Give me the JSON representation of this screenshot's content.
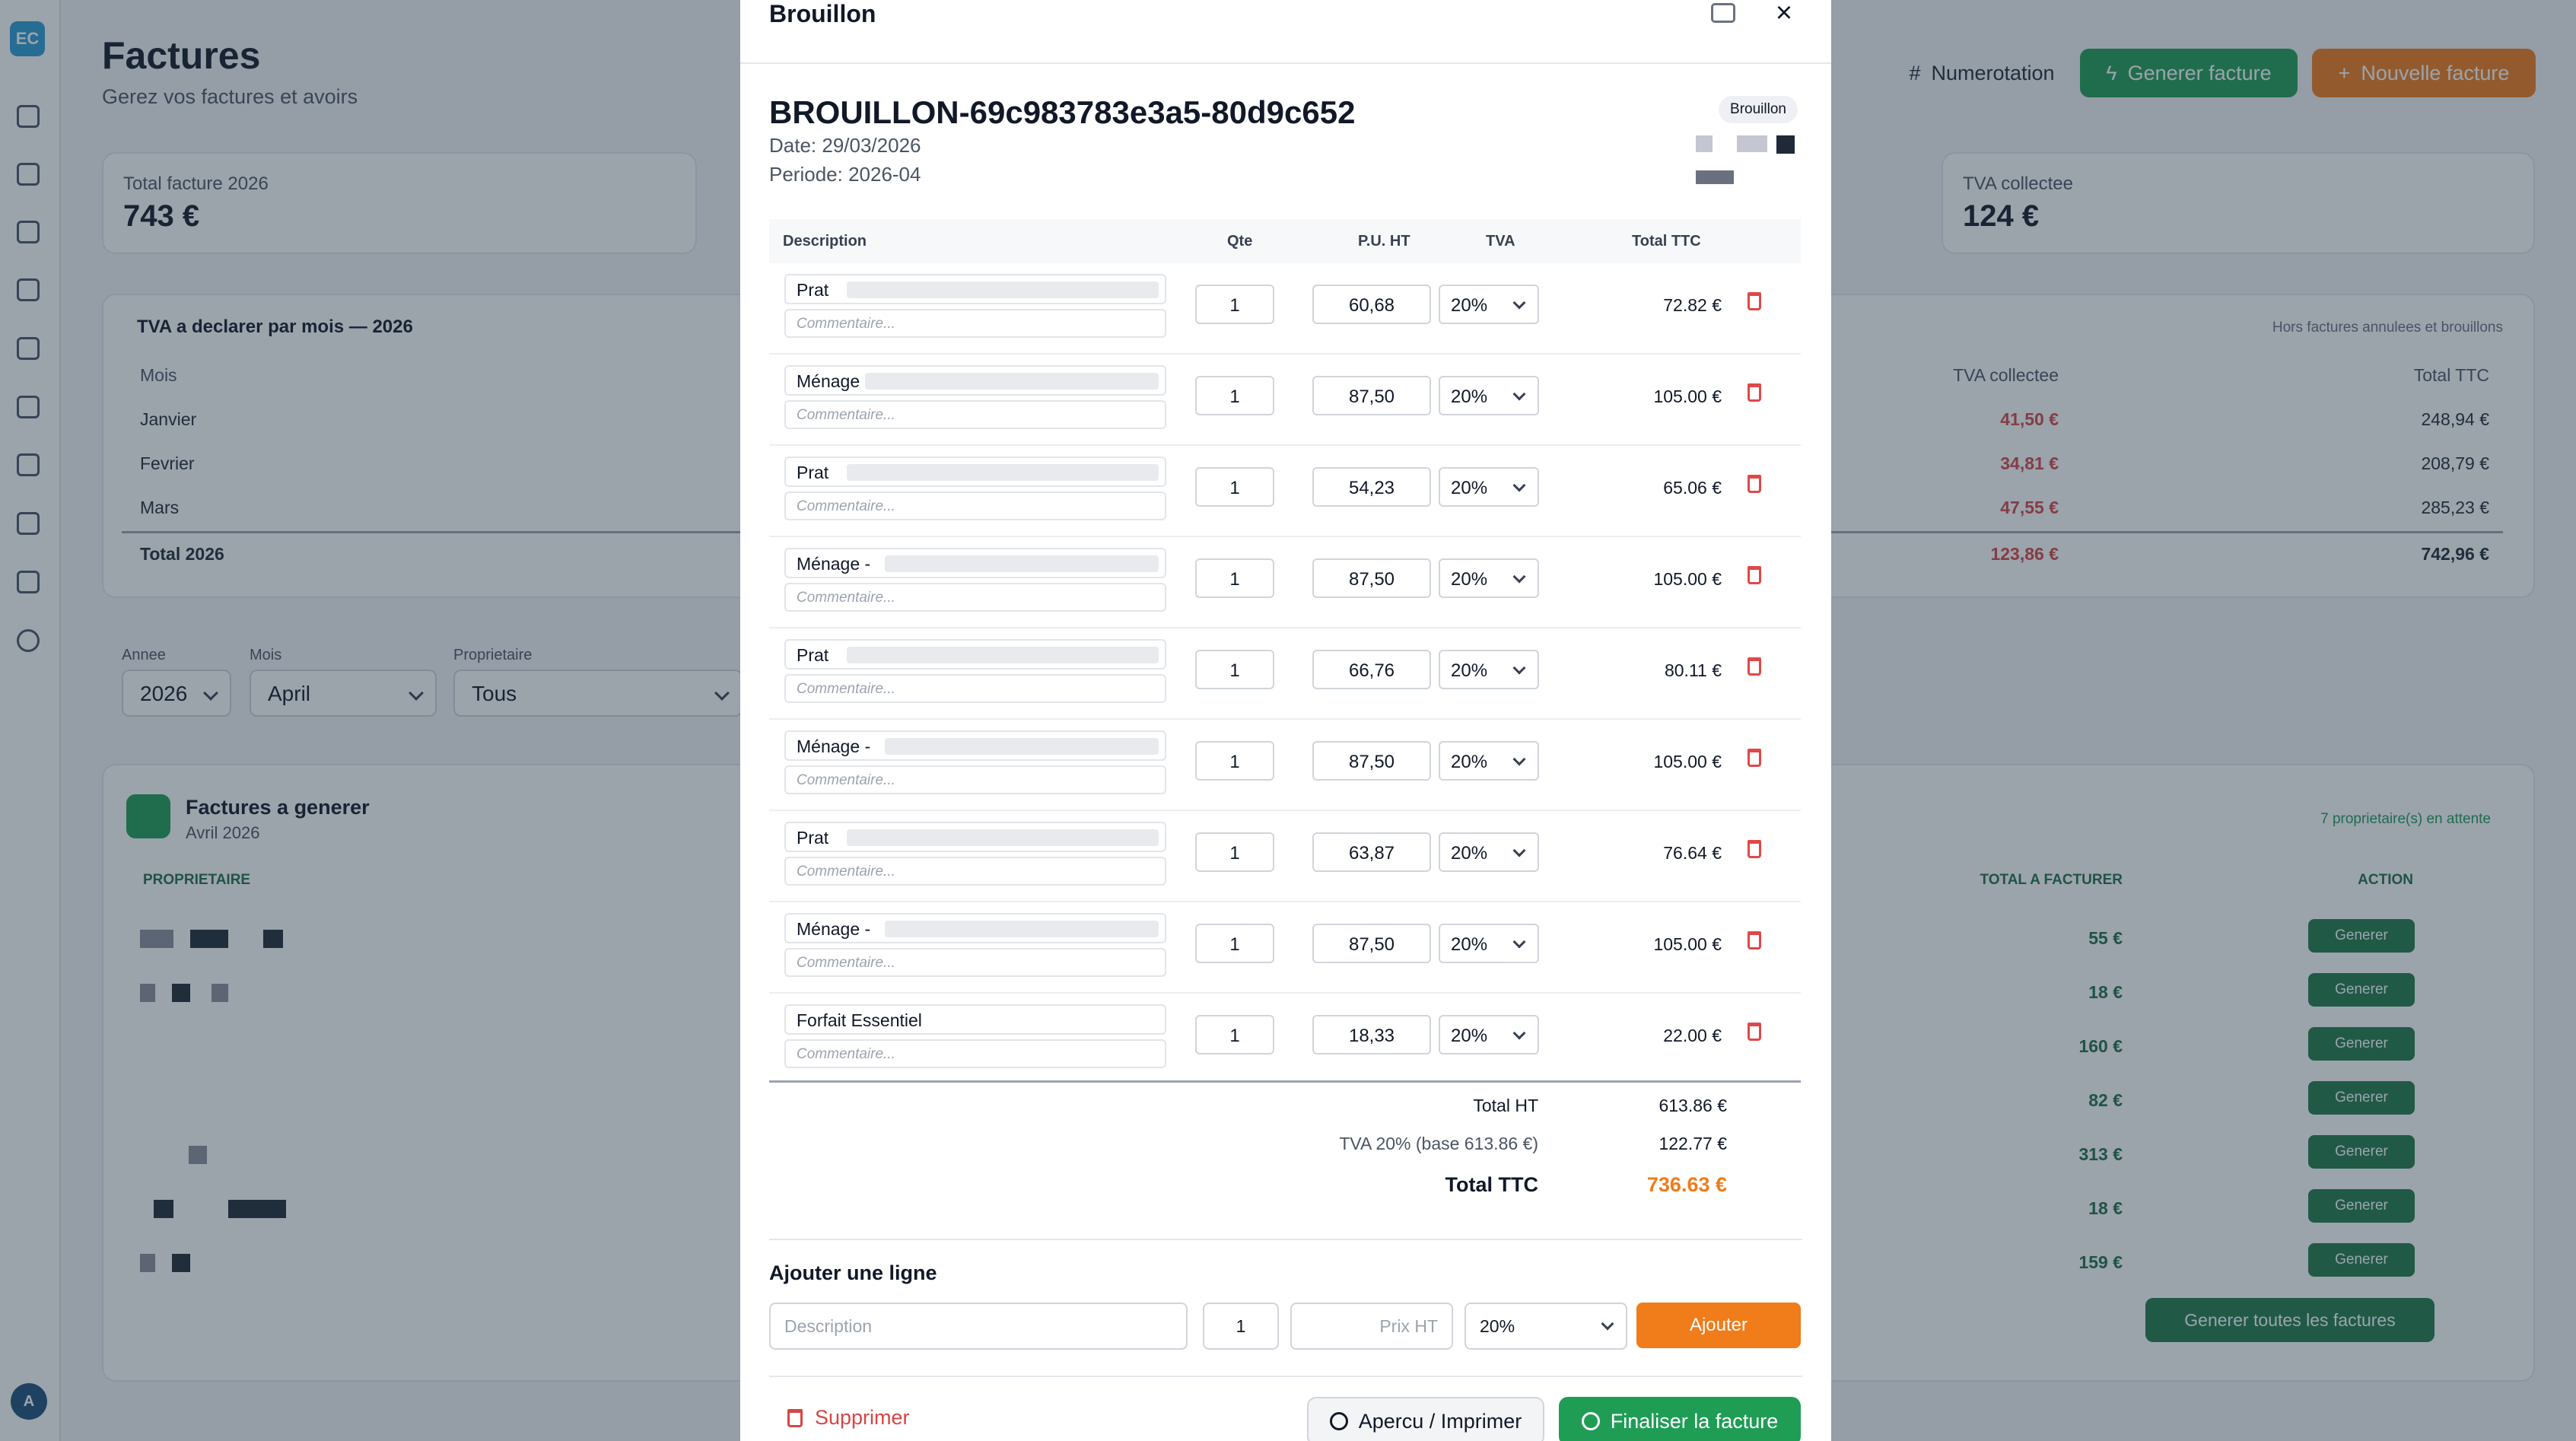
{
  "app": {
    "logo": "EC",
    "avatar": "A"
  },
  "rail_icons": [
    "dashboard-icon",
    "calendar-icon",
    "stats-icon",
    "messages-icon",
    "checklist-icon",
    "wallet-icon",
    "bank-icon",
    "search-user-icon",
    "billing-icon",
    "help-icon"
  ],
  "page": {
    "title": "Factures",
    "subtitle": "Gerez vos factures et avoirs",
    "buttons": {
      "numerotation": "Numerotation",
      "generer": "Generer facture",
      "nouvelle": "Nouvelle facture"
    }
  },
  "stats": [
    {
      "label": "Total facture 2026",
      "value": "743 €"
    },
    {
      "label": "TVA collectee",
      "value": "124 €"
    }
  ],
  "tva_table": {
    "title": "TVA a declarer par mois — 2026",
    "note": "Hors factures annulees et brouillons",
    "headers": {
      "month": "Mois",
      "collected": "TVA collectee",
      "ttc": "Total TTC"
    },
    "rows": [
      {
        "month": "Janvier",
        "collected": "41,50 €",
        "ttc": "248,94 €"
      },
      {
        "month": "Fevrier",
        "collected": "34,81 €",
        "ttc": "208,79 €"
      },
      {
        "month": "Mars",
        "collected": "47,55 €",
        "ttc": "285,23 €"
      }
    ],
    "total": {
      "month": "Total 2026",
      "collected": "123,86 €",
      "ttc": "742,96 €"
    }
  },
  "filters": {
    "annee": {
      "label": "Annee",
      "value": "2026"
    },
    "mois": {
      "label": "Mois",
      "value": "April"
    },
    "proprietaire": {
      "label": "Proprietaire",
      "value": "Tous"
    }
  },
  "to_generate": {
    "title": "Factures a generer",
    "subtitle": "Avril 2026",
    "pending": "7 proprietaire(s) en attente",
    "headers": {
      "owner": "PROPRIETAIRE",
      "total": "TOTAL A FACTURER",
      "action": "ACTION"
    },
    "rows": [
      {
        "amount": "55 €",
        "action": "Generer"
      },
      {
        "amount": "18 €",
        "action": "Generer"
      },
      {
        "amount": "160 €",
        "action": "Generer"
      },
      {
        "amount": "82 €",
        "action": "Generer"
      },
      {
        "amount": "313 €",
        "action": "Generer"
      },
      {
        "amount": "18 €",
        "action": "Generer"
      },
      {
        "amount": "159 €",
        "action": "Generer"
      }
    ],
    "generate_all": "Generer toutes les factures"
  },
  "modal": {
    "title": "Brouillon",
    "badge": "Brouillon",
    "invoice_number": "BROUILLON-69c983783e3a5-80d9c652",
    "date": "Date: 29/03/2026",
    "periode": "Periode: 2026-04",
    "columns": {
      "description": "Description",
      "qty": "Qte",
      "pu": "P.U. HT",
      "tva": "TVA",
      "ttc": "Total TTC"
    },
    "comment_placeholder": "Commentaire...",
    "lines": [
      {
        "desc": "Prat",
        "qty": "1",
        "pu": "60,68",
        "tva": "20%",
        "ttc": "72.82 €"
      },
      {
        "desc": "Ménage",
        "qty": "1",
        "pu": "87,50",
        "tva": "20%",
        "ttc": "105.00 €"
      },
      {
        "desc": "Prat",
        "qty": "1",
        "pu": "54,23",
        "tva": "20%",
        "ttc": "65.06 €"
      },
      {
        "desc": "Ménage -",
        "qty": "1",
        "pu": "87,50",
        "tva": "20%",
        "ttc": "105.00 €"
      },
      {
        "desc": "Prat",
        "qty": "1",
        "pu": "66,76",
        "tva": "20%",
        "ttc": "80.11 €"
      },
      {
        "desc": "Ménage -",
        "qty": "1",
        "pu": "87,50",
        "tva": "20%",
        "ttc": "105.00 €"
      },
      {
        "desc": "Prat",
        "qty": "1",
        "pu": "63,87",
        "tva": "20%",
        "ttc": "76.64 €"
      },
      {
        "desc": "Ménage -",
        "qty": "1",
        "pu": "87,50",
        "tva": "20%",
        "ttc": "105.00 €"
      },
      {
        "desc": "Forfait Essentiel",
        "qty": "1",
        "pu": "18,33",
        "tva": "20%",
        "ttc": "22.00 €"
      }
    ],
    "totals": {
      "ht_label": "Total HT",
      "ht": "613.86 €",
      "tva_label": "TVA 20% (base 613.86 €)",
      "tva": "122.77 €",
      "ttc_label": "Total TTC",
      "ttc": "736.63 €"
    },
    "add_line": {
      "title": "Ajouter une ligne",
      "desc_placeholder": "Description",
      "qty": "1",
      "price_placeholder": "Prix HT",
      "tva": "20%",
      "button": "Ajouter"
    },
    "footer": {
      "delete": "Supprimer",
      "preview": "Apercu / Imprimer",
      "finalize": "Finaliser la facture"
    }
  }
}
